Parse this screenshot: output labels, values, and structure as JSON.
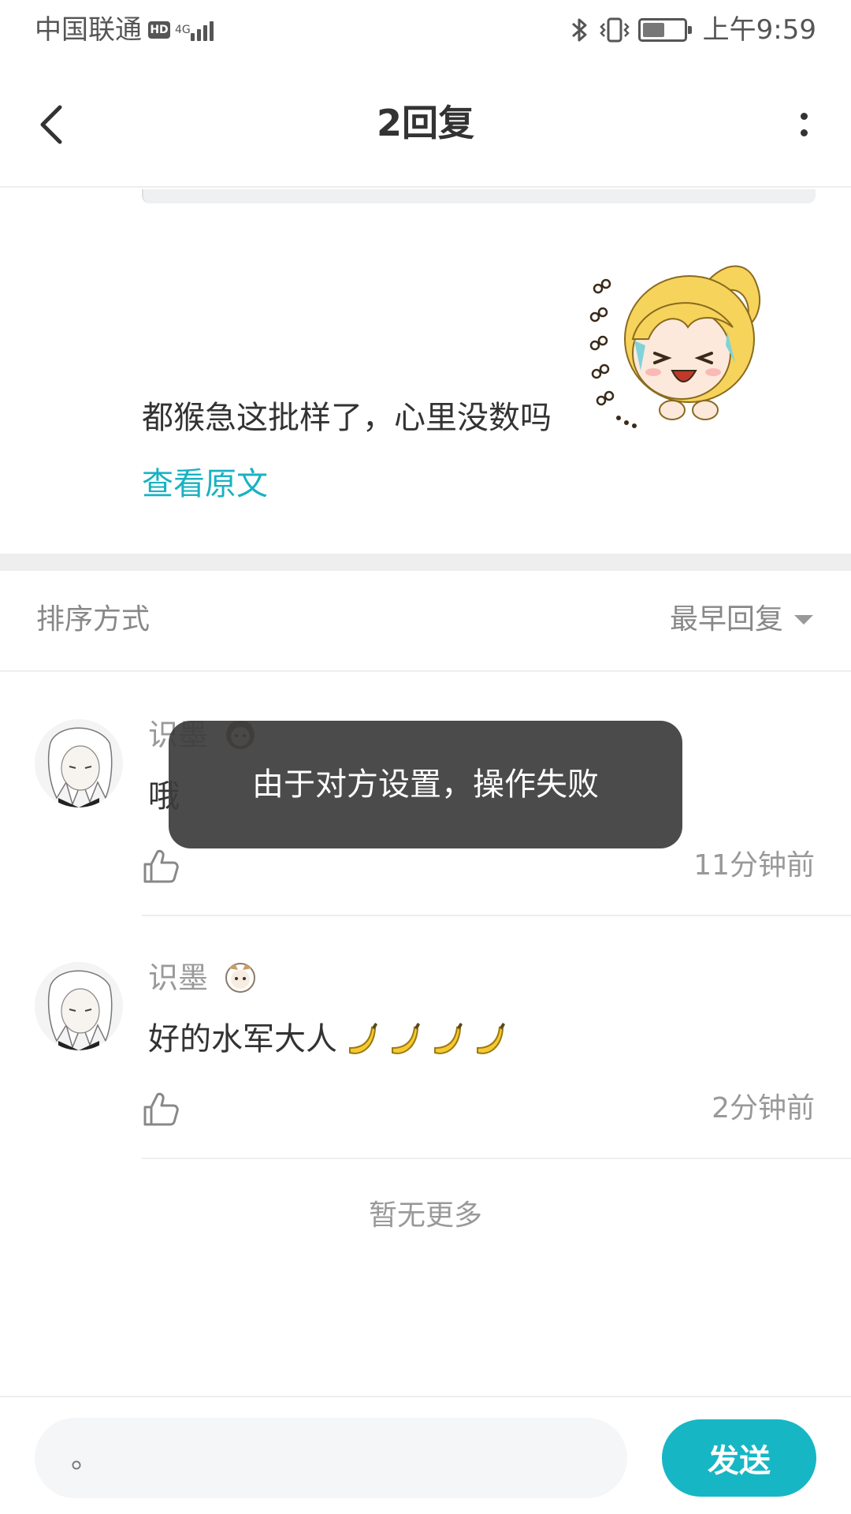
{
  "status_bar": {
    "carrier": "中国联通",
    "hd": "HD",
    "network": "4G",
    "time": "上午9:59",
    "battery_level": 0.55
  },
  "header": {
    "title": "2回复",
    "back_icon": "chevron-left-icon",
    "more_icon": "more-vertical-icon"
  },
  "post": {
    "text": "都猴急这批样了，心里没数吗",
    "view_original": "查看原文",
    "sticker": "anime-laughing-sticker"
  },
  "sort": {
    "label": "排序方式",
    "value": "最早回复"
  },
  "comments": [
    {
      "username": "识墨",
      "text": "哦",
      "time": "11分钟前",
      "emojis": []
    },
    {
      "username": "识墨",
      "text": "好的水军大人",
      "time": "2分钟前",
      "emojis": [
        "banana",
        "banana",
        "banana",
        "banana"
      ]
    }
  ],
  "no_more": "暂无更多",
  "toast": "由于对方设置，操作失败",
  "reply": {
    "placeholder": "。",
    "send_label": "发送"
  },
  "colors": {
    "accent": "#17b6c4",
    "link": "#1ab2c2",
    "toast_bg": "#3c3c3c"
  }
}
